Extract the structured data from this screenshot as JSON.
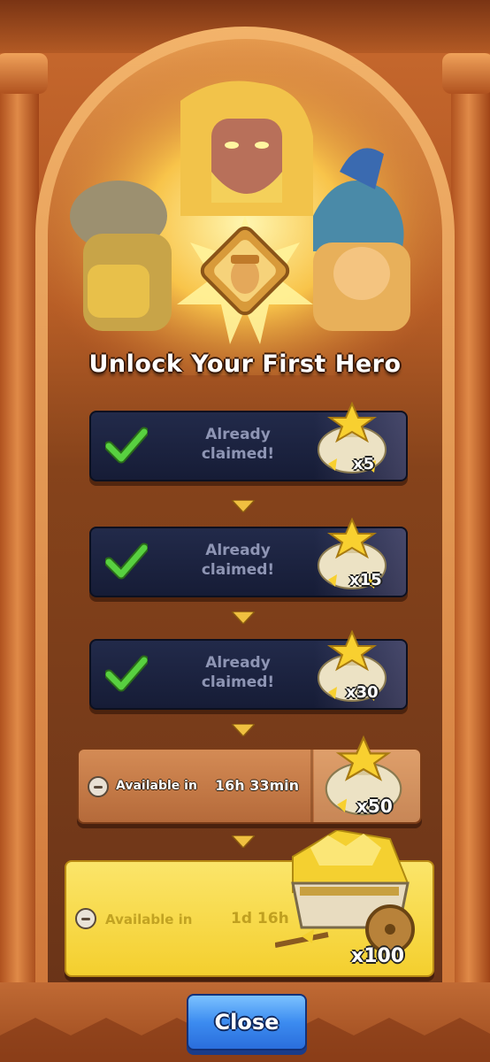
{
  "title": "Unlock Your First Hero",
  "steps": [
    {
      "status": "Already claimed!",
      "status_line1": "Already",
      "status_line2": "claimed!",
      "reward_qty": "x5",
      "claimed": true
    },
    {
      "status": "Already claimed!",
      "status_line1": "Already",
      "status_line2": "claimed!",
      "reward_qty": "x15",
      "claimed": true
    },
    {
      "status": "Already claimed!",
      "status_line1": "Already",
      "status_line2": "claimed!",
      "reward_qty": "x30",
      "claimed": true
    },
    {
      "available_label": "Available in",
      "time": "16h 33min",
      "reward_qty": "x50",
      "claimed": false
    },
    {
      "available_label": "Available in",
      "time": "1d 16h",
      "reward_qty": "x100",
      "claimed": false
    }
  ],
  "close_label": "Close",
  "icons": {
    "claimed": "checkmark-icon",
    "reward": "star-bag-icon",
    "big_reward": "gold-cart-icon",
    "timer": "timer-icon",
    "divider": "chevron-down-icon"
  },
  "colors": {
    "claimed_row": "#1c2440",
    "check": "#4cc23a",
    "next_row": "#c47a45",
    "final_row": "#f8da46",
    "close_button": "#3c8cf0"
  }
}
